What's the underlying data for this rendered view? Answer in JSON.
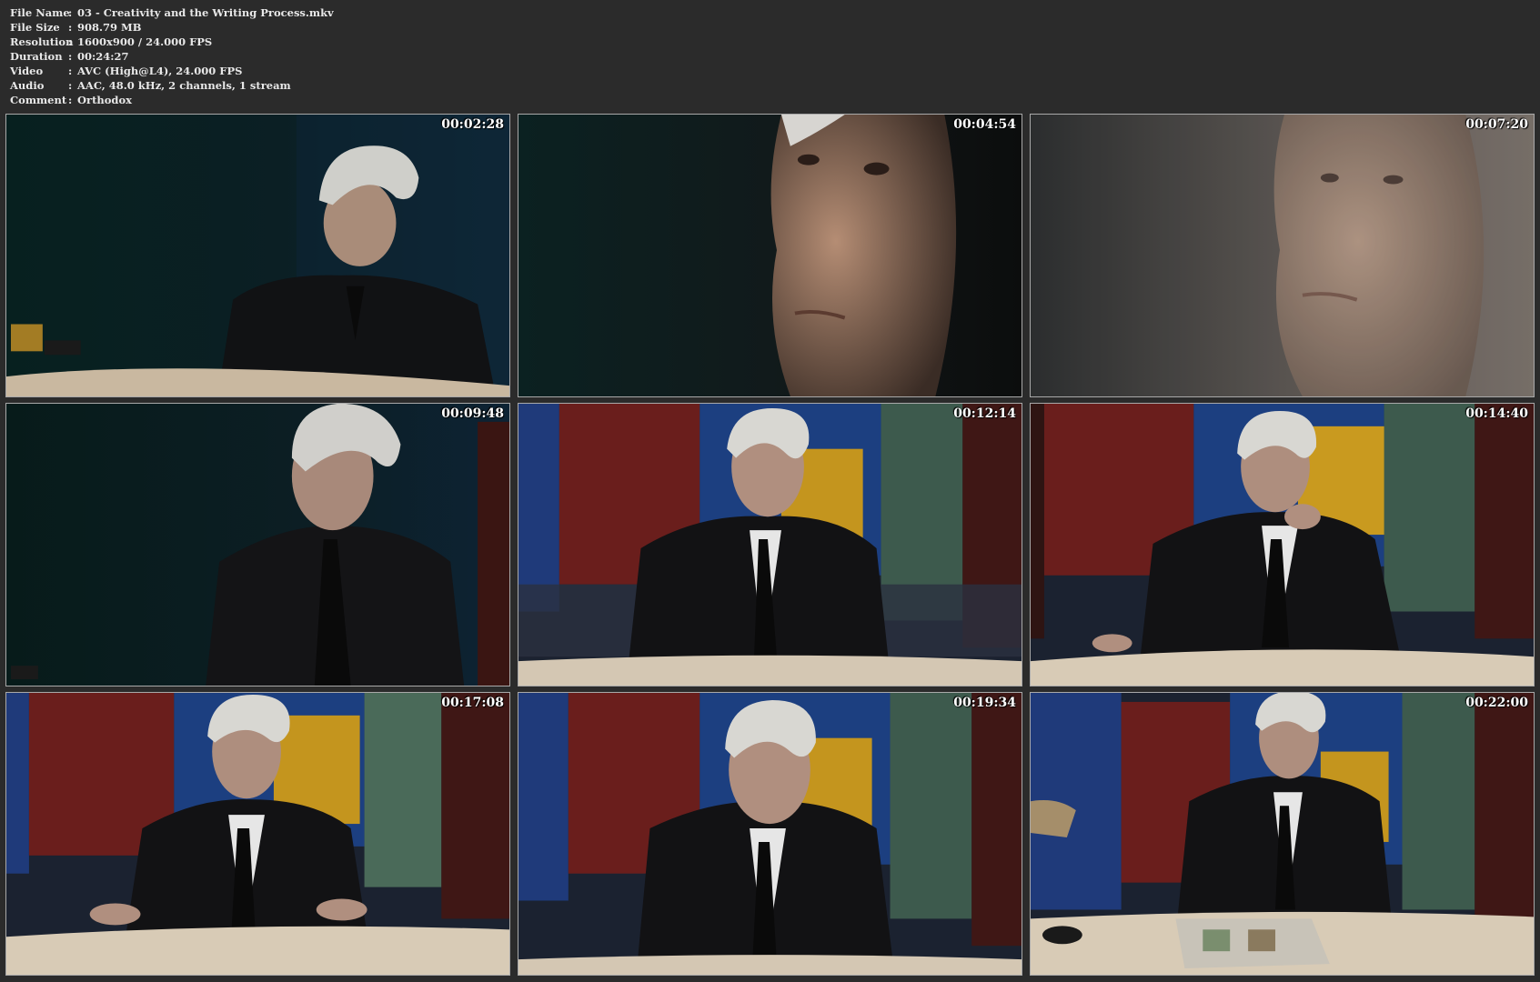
{
  "info": [
    {
      "key": "File Name",
      "value": "03 - Creativity and the Writing Process.mkv"
    },
    {
      "key": "File Size",
      "value": "908.79 MB"
    },
    {
      "key": "Resolution",
      "value": "1600x900 / 24.000 FPS"
    },
    {
      "key": "Duration",
      "value": "00:24:27"
    },
    {
      "key": "Video",
      "value": "AVC (High@L4), 24.000 FPS"
    },
    {
      "key": "Audio",
      "value": "AAC, 48.0 kHz, 2 channels, 1 stream"
    },
    {
      "key": "Comment",
      "value": "Orthodox"
    }
  ],
  "separator": ":",
  "thumbnails": [
    {
      "timestamp": "00:02:28"
    },
    {
      "timestamp": "00:04:54"
    },
    {
      "timestamp": "00:07:20"
    },
    {
      "timestamp": "00:09:48"
    },
    {
      "timestamp": "00:12:14"
    },
    {
      "timestamp": "00:14:40"
    },
    {
      "timestamp": "00:17:08"
    },
    {
      "timestamp": "00:19:34"
    },
    {
      "timestamp": "00:22:00"
    }
  ]
}
